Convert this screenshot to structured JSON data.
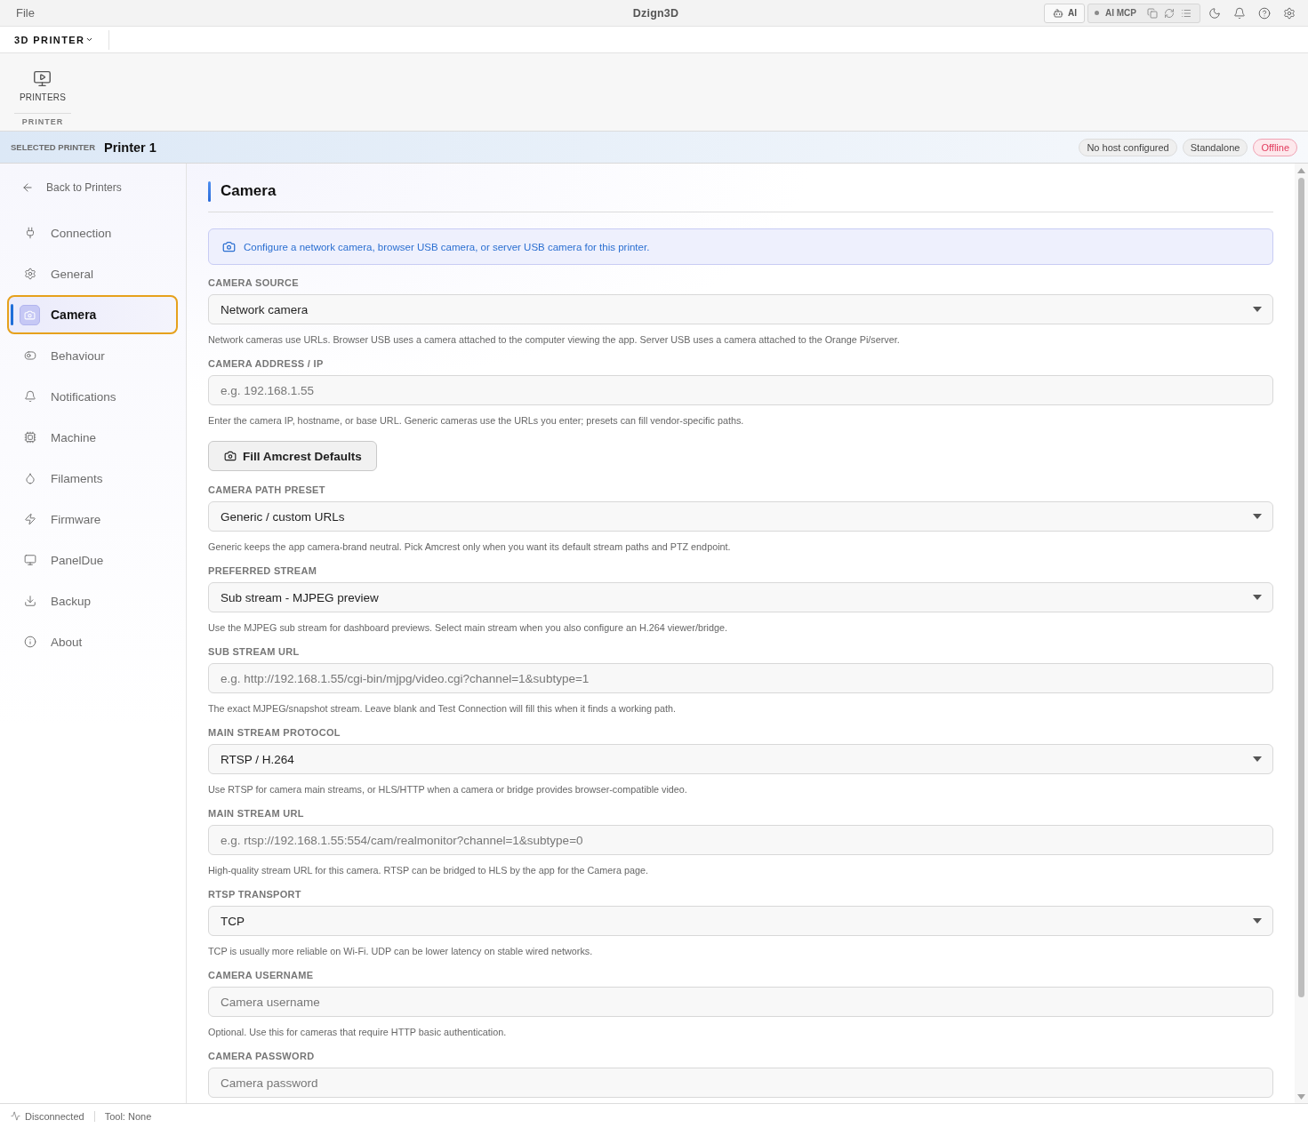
{
  "title_bar": {
    "menu": "File",
    "title": "Dzign3D",
    "ai_button": "AI",
    "mcp": {
      "label": "AI MCP",
      "connected": false
    }
  },
  "tab_bar": {
    "workspace": "3D PRINTER"
  },
  "ribbon": {
    "groups": [
      {
        "label": "PRINTER",
        "buttons": [
          {
            "label": "PRINTERS"
          }
        ]
      }
    ]
  },
  "selected_printer": {
    "label": "SELECTED PRINTER",
    "name": "Printer 1",
    "badges": [
      {
        "text": "No host configured",
        "kind": "neutral"
      },
      {
        "text": "Standalone",
        "kind": "neutral"
      },
      {
        "text": "Offline",
        "kind": "alert"
      }
    ]
  },
  "sidebar": {
    "back": "Back to Printers",
    "items": [
      {
        "label": "Connection",
        "selected": false
      },
      {
        "label": "General",
        "selected": false
      },
      {
        "label": "Camera",
        "selected": true
      },
      {
        "label": "Behaviour",
        "selected": false
      },
      {
        "label": "Notifications",
        "selected": false
      },
      {
        "label": "Machine",
        "selected": false
      },
      {
        "label": "Filaments",
        "selected": false
      },
      {
        "label": "Firmware",
        "selected": false
      },
      {
        "label": "PanelDue",
        "selected": false
      },
      {
        "label": "Backup",
        "selected": false
      },
      {
        "label": "About",
        "selected": false
      }
    ]
  },
  "page": {
    "title": "Camera",
    "notice": "Configure a network camera, browser USB camera, or server USB camera for this printer.",
    "fields": [
      {
        "kind": "select",
        "label": "CAMERA SOURCE",
        "value": "Network camera",
        "help": "Network cameras use URLs. Browser USB uses a camera attached to the computer viewing the app. Server USB uses a camera attached to the Orange Pi/server."
      },
      {
        "kind": "input",
        "label": "CAMERA ADDRESS / IP",
        "placeholder": "e.g. 192.168.1.55",
        "help": "Enter the camera IP, hostname, or base URL. Generic cameras use the URLs you enter; presets can fill vendor-specific paths."
      },
      {
        "kind": "button",
        "label": "Fill Amcrest Defaults"
      },
      {
        "kind": "select",
        "label": "CAMERA PATH PRESET",
        "value": "Generic / custom URLs",
        "help": "Generic keeps the app camera-brand neutral. Pick Amcrest only when you want its default stream paths and PTZ endpoint."
      },
      {
        "kind": "select",
        "label": "PREFERRED STREAM",
        "value": "Sub stream - MJPEG preview",
        "help": "Use the MJPEG sub stream for dashboard previews. Select main stream when you also configure an H.264 viewer/bridge."
      },
      {
        "kind": "input",
        "label": "SUB STREAM URL",
        "placeholder": "e.g. http://192.168.1.55/cgi-bin/mjpg/video.cgi?channel=1&subtype=1",
        "help": "The exact MJPEG/snapshot stream. Leave blank and Test Connection will fill this when it finds a working path."
      },
      {
        "kind": "select",
        "label": "MAIN STREAM PROTOCOL",
        "value": "RTSP / H.264",
        "help": "Use RTSP for camera main streams, or HLS/HTTP when a camera or bridge provides browser-compatible video."
      },
      {
        "kind": "input",
        "label": "MAIN STREAM URL",
        "placeholder": "e.g. rtsp://192.168.1.55:554/cam/realmonitor?channel=1&subtype=0",
        "help": "High-quality stream URL for this camera. RTSP can be bridged to HLS by the app for the Camera page."
      },
      {
        "kind": "select",
        "label": "RTSP TRANSPORT",
        "value": "TCP",
        "help": "TCP is usually more reliable on Wi-Fi. UDP can be lower latency on stable wired networks."
      },
      {
        "kind": "input",
        "label": "CAMERA USERNAME",
        "placeholder": "Camera username",
        "help": "Optional. Use this for cameras that require HTTP basic authentication."
      },
      {
        "kind": "input",
        "label": "CAMERA PASSWORD",
        "placeholder": "Camera password"
      }
    ]
  },
  "status_bar": {
    "connection": "Disconnected",
    "tool": "Tool: None"
  }
}
